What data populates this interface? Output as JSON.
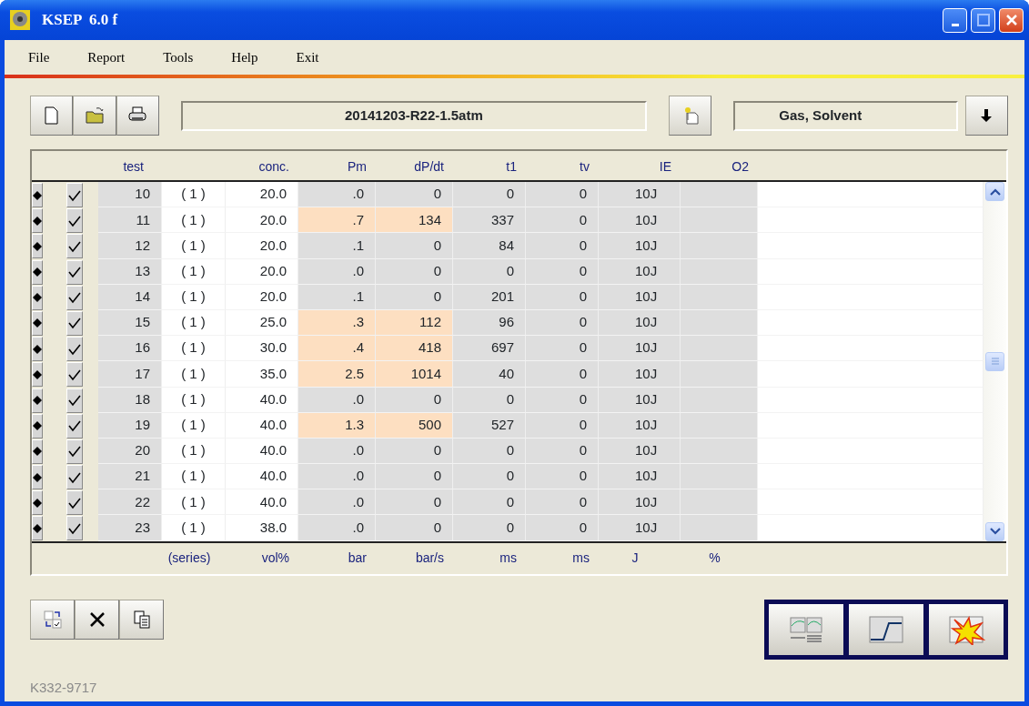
{
  "window": {
    "title": "KSEP  6.0 f"
  },
  "menu": [
    {
      "label": "File"
    },
    {
      "label": "Report"
    },
    {
      "label": "Tools"
    },
    {
      "label": "Help"
    },
    {
      "label": "Exit"
    }
  ],
  "toolbar": {
    "file_name": "20141203-R22-1.5atm",
    "category": "Gas, Solvent"
  },
  "table": {
    "columns": [
      {
        "header": "test"
      },
      {},
      {
        "header": "conc."
      },
      {
        "header": "Pm"
      },
      {
        "header": "dP/dt"
      },
      {
        "header": "t1"
      },
      {
        "header": "tv"
      },
      {
        "header": "IE"
      },
      {
        "header": "O2"
      }
    ],
    "rows": [
      {
        "cells": [
          "10",
          "( 1 )",
          "20.0",
          ".0",
          "0",
          "0",
          "0",
          "10J"
        ],
        "checked": true,
        "highlighted": false
      },
      {
        "cells": [
          "11",
          "( 1 )",
          "20.0",
          ".7",
          "134",
          "337",
          "0",
          "10J"
        ],
        "checked": true,
        "highlighted": true
      },
      {
        "cells": [
          "12",
          "( 1 )",
          "20.0",
          ".1",
          "0",
          "84",
          "0",
          "10J"
        ],
        "checked": true,
        "highlighted": false
      },
      {
        "cells": [
          "13",
          "( 1 )",
          "20.0",
          ".0",
          "0",
          "0",
          "0",
          "10J"
        ],
        "checked": true,
        "highlighted": false
      },
      {
        "cells": [
          "14",
          "( 1 )",
          "20.0",
          ".1",
          "0",
          "201",
          "0",
          "10J"
        ],
        "checked": true,
        "highlighted": false
      },
      {
        "cells": [
          "15",
          "( 1 )",
          "25.0",
          ".3",
          "112",
          "96",
          "0",
          "10J"
        ],
        "checked": true,
        "highlighted": true
      },
      {
        "cells": [
          "16",
          "( 1 )",
          "30.0",
          ".4",
          "418",
          "697",
          "0",
          "10J"
        ],
        "checked": true,
        "highlighted": true
      },
      {
        "cells": [
          "17",
          "( 1 )",
          "35.0",
          "2.5",
          "1014",
          "40",
          "0",
          "10J"
        ],
        "checked": true,
        "highlighted": true
      },
      {
        "cells": [
          "18",
          "( 1 )",
          "40.0",
          ".0",
          "0",
          "0",
          "0",
          "10J"
        ],
        "checked": true,
        "highlighted": false
      },
      {
        "cells": [
          "19",
          "( 1 )",
          "40.0",
          "1.3",
          "500",
          "527",
          "0",
          "10J"
        ],
        "checked": true,
        "highlighted": true
      },
      {
        "cells": [
          "20",
          "( 1 )",
          "40.0",
          ".0",
          "0",
          "0",
          "0",
          "10J"
        ],
        "checked": true,
        "highlighted": false
      },
      {
        "cells": [
          "21",
          "( 1 )",
          "40.0",
          ".0",
          "0",
          "0",
          "0",
          "10J"
        ],
        "checked": true,
        "highlighted": false
      },
      {
        "cells": [
          "22",
          "( 1 )",
          "40.0",
          ".0",
          "0",
          "0",
          "0",
          "10J"
        ],
        "checked": true,
        "highlighted": false
      },
      {
        "cells": [
          "23",
          "( 1 )",
          "38.0",
          ".0",
          "0",
          "0",
          "0",
          "10J"
        ],
        "checked": true,
        "highlighted": false
      }
    ],
    "units": [
      "(series)",
      "vol%",
      "bar",
      "bar/s",
      "ms",
      "ms",
      "J",
      "%"
    ]
  },
  "footer": {
    "code": "K332-9717"
  }
}
